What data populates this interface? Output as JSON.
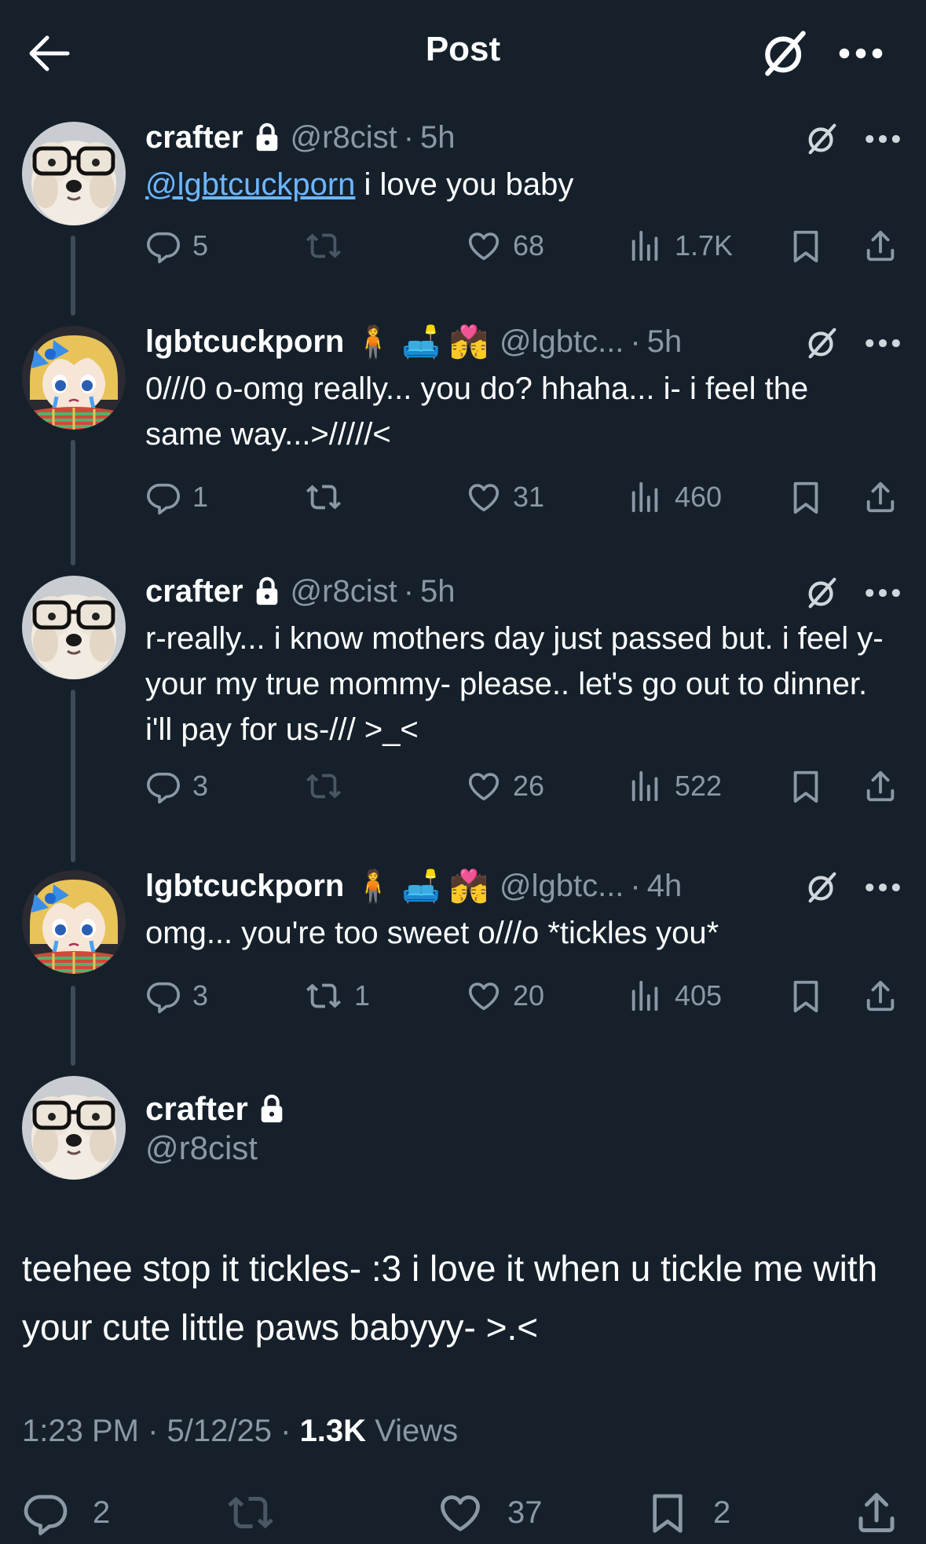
{
  "header": {
    "title": "Post"
  },
  "thread": [
    {
      "name": "crafter",
      "locked": true,
      "emojis": "",
      "handle": "@r8cist",
      "time": "5h",
      "mention": "@lgbtcuckporn",
      "text": " i love you baby",
      "replies": "5",
      "reposts": "",
      "likes": "68",
      "views": "1.7K"
    },
    {
      "name": "lgbtcuckporn",
      "locked": false,
      "emojis": "🧍 🛋️ 💏",
      "handle": "@lgbtc...",
      "time": "5h",
      "mention": "",
      "text": "0///0 o-omg really... you do? hhaha... i- i feel the same way...>/////<",
      "replies": "1",
      "reposts": "",
      "likes": "31",
      "views": "460"
    },
    {
      "name": "crafter",
      "locked": true,
      "emojis": "",
      "handle": "@r8cist",
      "time": "5h",
      "mention": "",
      "text": "r-really... i know mothers day just passed but. i feel y-your my true mommy- please.. let's go out to dinner. i'll pay for us-/// >_<",
      "replies": "3",
      "reposts": "",
      "likes": "26",
      "views": "522"
    },
    {
      "name": "lgbtcuckporn",
      "locked": false,
      "emojis": "🧍 🛋️ 💏",
      "handle": "@lgbtc...",
      "time": "4h",
      "mention": "",
      "text": "omg... you're too sweet o///o *tickles you*",
      "replies": "3",
      "reposts": "1",
      "likes": "20",
      "views": "405"
    }
  ],
  "main_post": {
    "name": "crafter",
    "handle": "@r8cist",
    "text": "teehee stop it tickles- :3 i love it when u tickle me with your cute little paws babyyy- >.<",
    "time": "1:23 PM",
    "date": "5/12/25",
    "views_count": "1.3K",
    "views_label": "Views",
    "replies": "2",
    "reposts": "",
    "likes": "37",
    "bookmarks": "2"
  },
  "colors": {
    "background": "#15202b",
    "muted": "#8b98a5",
    "link": "#6cb6ff",
    "thread_line": "#3d4a58"
  },
  "icons": [
    "back-arrow-icon",
    "grok-icon",
    "more-icon",
    "lock-icon",
    "reply-icon",
    "repost-icon",
    "like-icon",
    "views-icon",
    "bookmark-icon",
    "share-icon"
  ]
}
